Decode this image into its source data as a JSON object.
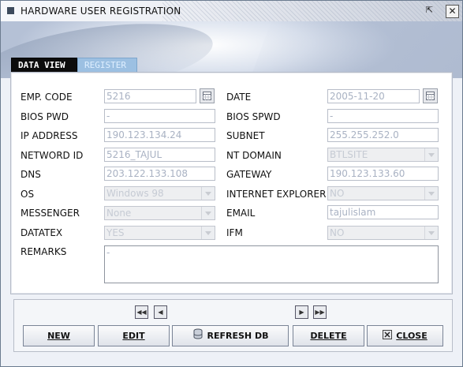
{
  "window": {
    "title": "HARDWARE USER REGISTRATION",
    "restore_glyph": "⇱",
    "close_glyph": "✕"
  },
  "tabs": [
    {
      "label": "DATA VIEW",
      "active": true
    },
    {
      "label": "REGISTER",
      "active": false
    }
  ],
  "form": {
    "emp_code": {
      "label": "EMP. CODE",
      "value": "5216"
    },
    "date": {
      "label": "DATE",
      "value": "2005-11-20"
    },
    "bios_pwd": {
      "label": "BIOS PWD",
      "value": "-"
    },
    "bios_spwd": {
      "label": "BIOS SPWD",
      "value": "-"
    },
    "ip_address": {
      "label": "IP ADDRESS",
      "value": "190.123.134.24"
    },
    "subnet": {
      "label": "SUBNET",
      "value": "255.255.252.0"
    },
    "network_id": {
      "label": "NETWORD ID",
      "value": "5216_TAJUL"
    },
    "nt_domain": {
      "label": "NT DOMAIN",
      "value": "BTLSITE"
    },
    "dns": {
      "label": "DNS",
      "value": "203.122.133.108"
    },
    "gateway": {
      "label": "GATEWAY",
      "value": "190.123.133.60"
    },
    "os": {
      "label": "OS",
      "value": "Windows 98"
    },
    "internet_explorer": {
      "label": "INTERNET EXPLORER",
      "value": "NO"
    },
    "messenger": {
      "label": "MESSENGER",
      "value": "None"
    },
    "email": {
      "label": "EMAIL",
      "value": "tajulislam"
    },
    "datatex": {
      "label": "DATATEX",
      "value": "YES"
    },
    "ifm": {
      "label": "IFM",
      "value": "NO"
    },
    "remarks": {
      "label": "REMARKS",
      "value": "-"
    }
  },
  "nav": {
    "first": "◀◀",
    "prev": "◀",
    "next": "▶",
    "last": "▶▶"
  },
  "buttons": {
    "new": "NEW",
    "edit": "EDIT",
    "refresh": "REFRESH DB",
    "delete": "DELETE",
    "close": "CLOSE"
  }
}
